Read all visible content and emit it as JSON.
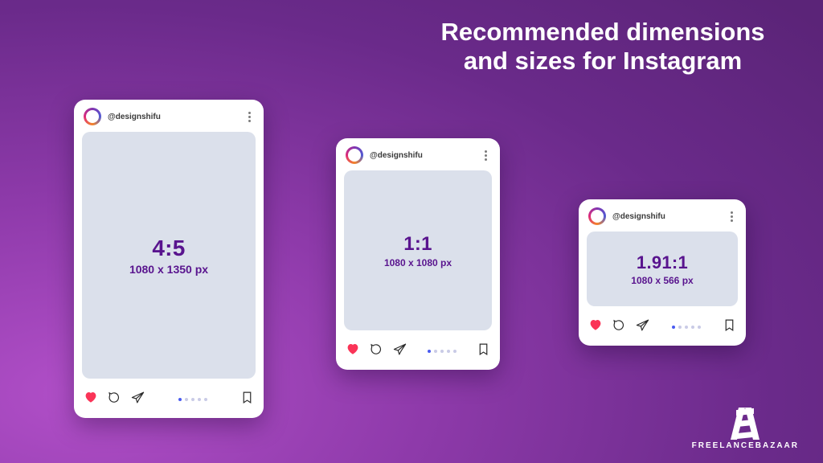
{
  "title": "Recommended dimensions and sizes for Instagram",
  "username": "@designshifu",
  "brand": "FREELANCEBAZAAR",
  "colors": {
    "accent": "#59148e",
    "heart": "#fa3457"
  },
  "cards": [
    {
      "key": "portrait",
      "ratio": "4:5",
      "dims": "1080 x 1350 px"
    },
    {
      "key": "square",
      "ratio": "1:1",
      "dims": "1080 x 1080 px"
    },
    {
      "key": "landscape",
      "ratio": "1.91:1",
      "dims": "1080 x 566 px"
    }
  ]
}
